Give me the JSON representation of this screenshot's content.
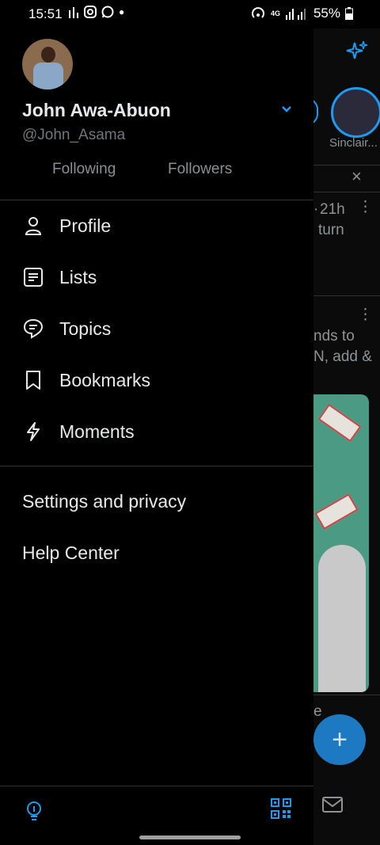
{
  "status": {
    "time": "15:51",
    "battery": "55%",
    "network": "4G"
  },
  "profile": {
    "name": "John Awa-Abuon",
    "handle": "@John_Asama",
    "following_label": "Following",
    "followers_label": "Followers"
  },
  "menu": [
    {
      "label": "Profile",
      "icon": "person-icon"
    },
    {
      "label": "Lists",
      "icon": "list-icon"
    },
    {
      "label": "Topics",
      "icon": "topics-icon"
    },
    {
      "label": "Bookmarks",
      "icon": "bookmark-icon"
    },
    {
      "label": "Moments",
      "icon": "lightning-icon"
    }
  ],
  "secondary": {
    "settings": "Settings and privacy",
    "help": "Help Center"
  },
  "background": {
    "fleet_name": "Sinclair...",
    "tweet1_time": "21h",
    "tweet1_text": "turn",
    "tweet2_line1": "nds to",
    "tweet2_line2": "N, add &",
    "tweet3_text": "e"
  },
  "colors": {
    "accent": "#1d9bf0",
    "background": "#000000",
    "text": "#e7e9ea",
    "muted": "#71767b"
  }
}
